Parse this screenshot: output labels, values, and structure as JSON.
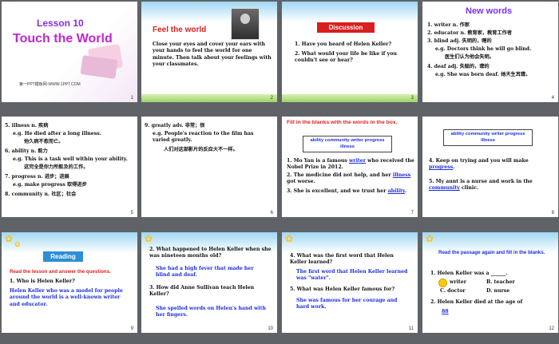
{
  "s1": {
    "lesson": "Lesson 10",
    "title": "Touch the World",
    "watermark": "第一PPT模板网-WWW.1PPT.COM",
    "num": "1"
  },
  "s2": {
    "title": "Feel the world",
    "body": "Close your eyes and cover your ears with your hands to feel the world for one minute. Then talk about your feelings with your classmates.",
    "num": "2"
  },
  "s3": {
    "title": "Discussion",
    "q1": "1. Have you heard of Helen Keller?",
    "q2": "2. What would your life be like if you couldn't see or hear?",
    "num": "3"
  },
  "s4": {
    "title": "New words",
    "lines": [
      "1. writer n. 作家",
      "2. educator n. 教育家，教育工作者",
      "3. blind adj. 失明的，瞎的",
      "e.g. Doctors think he will go blind.",
      "医生们认为他会失明。",
      "4. deaf adj. 失聪的，聋的",
      "e.g. She was born deaf. 她天生耳聋。"
    ],
    "num": "4"
  },
  "s5": {
    "lines": [
      "5. illness n. 疾病",
      "e.g. He died after a long illness.",
      "他久病不愈而亡。",
      "6. ability n. 能力",
      "e.g. This is a task well within your ability.",
      "这完全是你力所能及的工作。",
      "7. progress n. 进步；进展",
      "e.g. make progress 取得进步",
      "8. community n. 社区；社会"
    ],
    "num": "5"
  },
  "s6": {
    "lines": [
      "9. greatly adv. 非常；很",
      "e.g. People's reaction to the film has varied greatly.",
      "人们对这部影片的反应大不一样。"
    ],
    "num": "6"
  },
  "s7": {
    "title": "Fill in the blanks with the words in the box.",
    "box": "ability  community  writer progress  illness",
    "l1": "1. Mo Yan is a famous",
    "a1": "writer",
    "l1b": "who received the Nobel Prize in 2012.",
    "l2": "2. The medicine did not help, and her",
    "a2": "illness",
    "l2b": "got worse.",
    "l3": "3. She is excellent, and we trust her",
    "a3": "ability",
    "num": "7"
  },
  "s8": {
    "box": "ability  community  writer progress  illness",
    "l4": "4. Keep on trying and you will make",
    "a4": "progress",
    "l5": "5. My aunt is a nurse and work in the",
    "a5": "community",
    "l5b": "clinic.",
    "num": "8"
  },
  "s9": {
    "label": "Reading",
    "instr": "Read the lesson and answer the questions.",
    "q1": "1. Who is Helen Keller?",
    "a1": "Helen Keller who was a model for people around the world is a well-known writer and educator.",
    "num": "9"
  },
  "s10": {
    "q2": "2. What happened to Helen Keller when she was nineteen months old?",
    "a2": "She had a high fever that made her blind and deaf.",
    "q3": "3. How did Anne Sullivan teach Helen Keller?",
    "a3": "She spelled words on Helen's hand with her fingers.",
    "num": "10"
  },
  "s11": {
    "q4": "4. What was the first word that Helen Keller learned?",
    "a4": "The first word that Helen Keller learned was \"water\".",
    "q5": "5. What was Helen Keller famous for?",
    "a5": "She was famous for her courage and hard work.",
    "num": "11"
  },
  "s12": {
    "instr": "Read the passage again and fill in the blanks.",
    "q1": "1. Helen Keller was a ______.",
    "oa": "writer",
    "ob": "B. teacher",
    "oc": "C. doctor",
    "od": "D. nurse",
    "q2": "2. Helen Keller died at the age of",
    "a2": "88",
    "num": "12"
  }
}
